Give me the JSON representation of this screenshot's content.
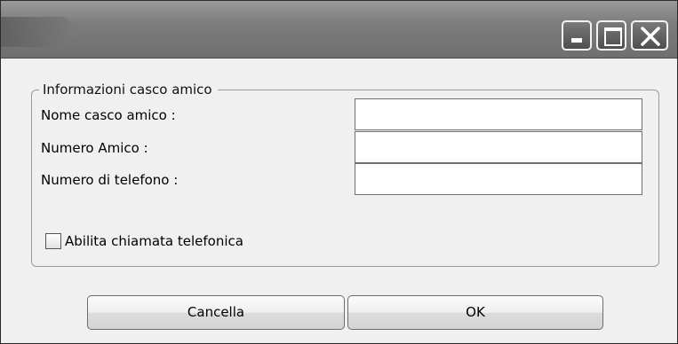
{
  "window": {
    "caption_buttons": {
      "minimize_icon": "minimize-icon",
      "maximize_icon": "maximize-icon",
      "close_icon": "close-icon"
    }
  },
  "group": {
    "legend": "Informazioni casco amico",
    "fields": [
      {
        "label": "Nome casco amico :",
        "value": ""
      },
      {
        "label": "Numero Amico :",
        "value": ""
      },
      {
        "label": "Numero di telefono :",
        "value": ""
      }
    ],
    "checkbox": {
      "label": "Abilita chiamata telefonica",
      "checked": false
    }
  },
  "buttons": {
    "cancel_label": "Cancella",
    "ok_label": "OK"
  }
}
